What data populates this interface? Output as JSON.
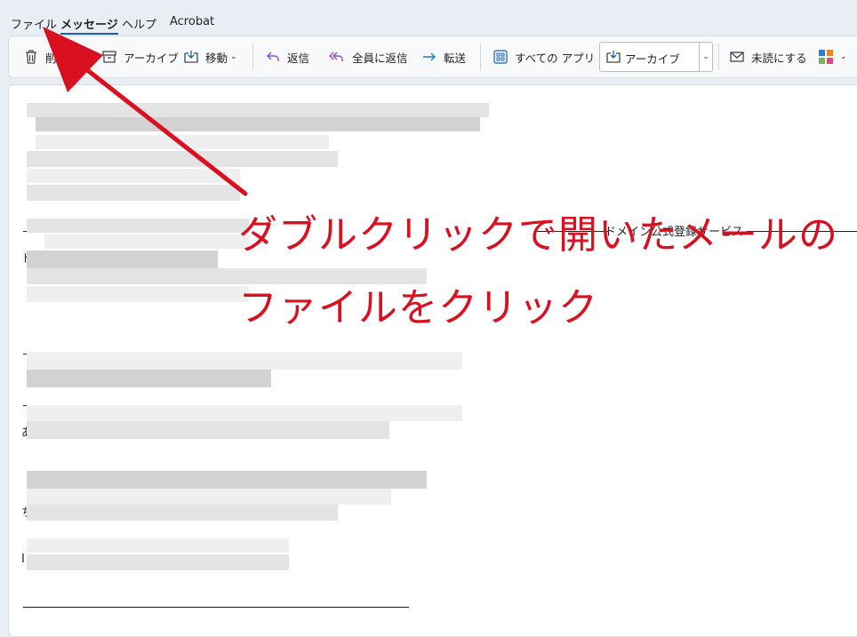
{
  "menubar": {
    "items": [
      {
        "label": "ファイル"
      },
      {
        "label": "メッセージ"
      },
      {
        "label": "ヘルプ"
      },
      {
        "label": "Acrobat"
      }
    ]
  },
  "ribbon": {
    "delete_label": "削除",
    "archive_label": "アーカイブ",
    "move_label": "移動",
    "reply_label": "返信",
    "reply_all_label": "全員に返信",
    "forward_label": "転送",
    "all_apps_label": "すべての アプリ",
    "quick_step_value": "アーカイブ",
    "mark_unread_label": "未読にする"
  },
  "email": {
    "service_header": "ドメイン公式登録サービス",
    "fragment_1": "ド",
    "fragment_2": "あ",
    "fragment_3": "ち",
    "fragment_4": "I"
  },
  "annotation": {
    "line1": "ダブルクリックで開いたメールの",
    "line2": "ファイルをクリック",
    "color": "#d9101f"
  },
  "colors": {
    "accent": "#1a5fb4",
    "annotation_red": "#d9101f"
  }
}
